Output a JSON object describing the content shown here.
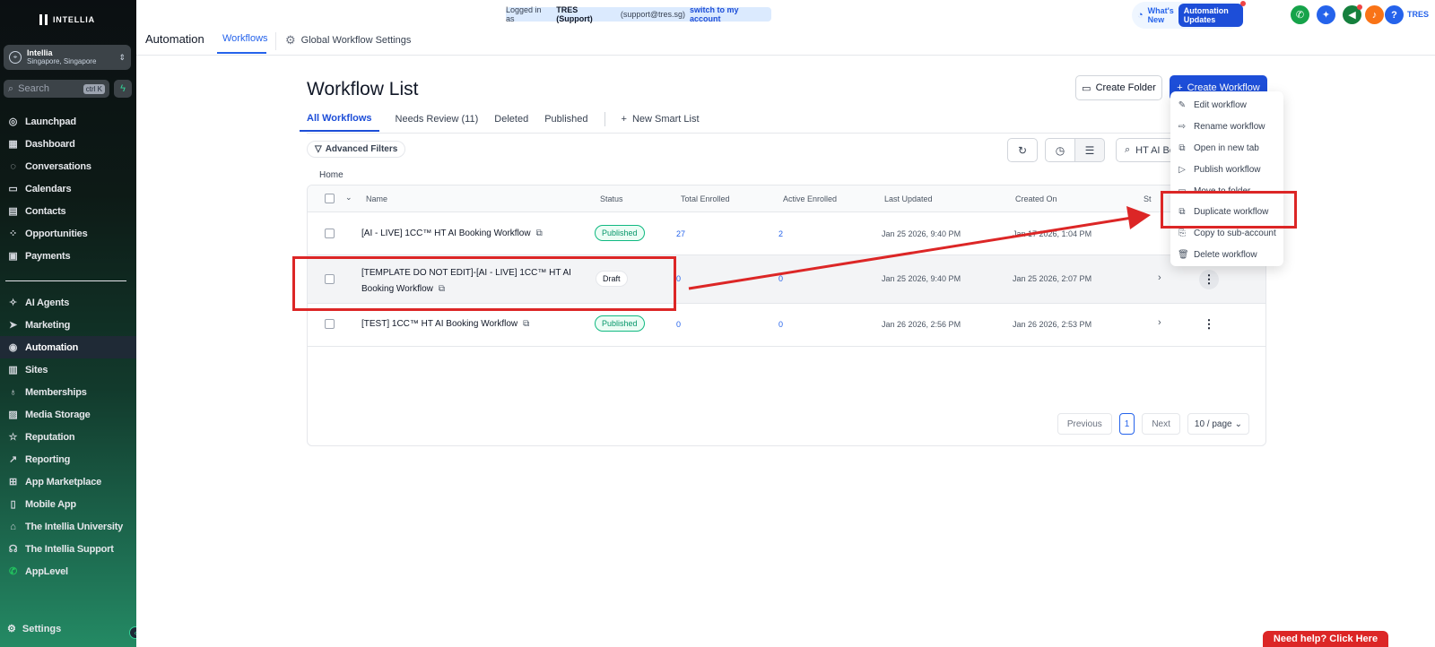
{
  "app": {
    "brand": "INTELLIA",
    "account_name": "Intellia",
    "account_location": "Singapore, Singapore"
  },
  "sidebar": {
    "search_placeholder": "Search",
    "search_shortcut": "ctrl K",
    "items": [
      {
        "label": "Launchpad",
        "icon": "rocket-icon"
      },
      {
        "label": "Dashboard",
        "icon": "grid-icon"
      },
      {
        "label": "Conversations",
        "icon": "chat-icon"
      },
      {
        "label": "Calendars",
        "icon": "calendar-icon"
      },
      {
        "label": "Contacts",
        "icon": "contacts-icon"
      },
      {
        "label": "Opportunities",
        "icon": "opportunities-icon"
      },
      {
        "label": "Payments",
        "icon": "payments-icon"
      }
    ],
    "items2": [
      {
        "label": "AI Agents",
        "icon": "sparkle-icon"
      },
      {
        "label": "Marketing",
        "icon": "send-icon"
      },
      {
        "label": "Automation",
        "icon": "automation-icon",
        "active": true
      },
      {
        "label": "Sites",
        "icon": "sites-icon"
      },
      {
        "label": "Memberships",
        "icon": "memberships-icon"
      },
      {
        "label": "Media Storage",
        "icon": "media-icon"
      },
      {
        "label": "Reputation",
        "icon": "star-icon"
      },
      {
        "label": "Reporting",
        "icon": "chart-icon"
      },
      {
        "label": "App Marketplace",
        "icon": "apps-icon"
      },
      {
        "label": "Mobile App",
        "icon": "mobile-icon"
      },
      {
        "label": "The Intellia University",
        "icon": "graduation-icon"
      },
      {
        "label": "The Intellia Support",
        "icon": "support-icon"
      },
      {
        "label": "AppLevel",
        "icon": "whatsapp-icon"
      }
    ],
    "settings_label": "Settings"
  },
  "topbar": {
    "page_title": "Automation",
    "tab_workflows": "Workflows",
    "global_settings": "Global Workflow Settings",
    "login_prefix": "Logged in as",
    "login_user": "TRES (Support)",
    "login_email": "(support@tres.sg)",
    "login_switch": "switch to my account",
    "whats_new": "What's New",
    "automation_updates": "Automation Updates",
    "user_initials": "TRES"
  },
  "main": {
    "title": "Workflow List",
    "create_folder": "Create Folder",
    "create_workflow": "Create Workflow",
    "tabs": [
      "All Workflows",
      "Needs Review (11)",
      "Deleted",
      "Published"
    ],
    "new_smart_list": "New Smart List",
    "advanced_filters": "Advanced Filters",
    "search_value": "HT AI Bo",
    "breadcrumb": "Home",
    "columns": [
      "Name",
      "Status",
      "Total Enrolled",
      "Active Enrolled",
      "Last Updated",
      "Created On",
      "St"
    ],
    "rows": [
      {
        "name": "[AI - LIVE] 1CC™ HT AI Booking Workflow",
        "status": "Published",
        "total": "27",
        "active": "2",
        "updated": "Jan 25 2026, 9:40 PM",
        "created": "Jan 17 2026, 1:04 PM"
      },
      {
        "name_line1": "[TEMPLATE DO NOT EDIT]-[AI - LIVE] 1CC™ HT AI",
        "name_line2": "Booking Workflow",
        "status": "Draft",
        "total": "0",
        "active": "0",
        "updated": "Jan 25 2026, 9:40 PM",
        "created": "Jan 25 2026, 2:07 PM"
      },
      {
        "name": "[TEST] 1CC™ HT AI Booking Workflow",
        "status": "Published",
        "total": "0",
        "active": "0",
        "updated": "Jan 26 2026, 2:56 PM",
        "created": "Jan 26 2026, 2:53 PM"
      }
    ],
    "pager": {
      "previous": "Previous",
      "page": "1",
      "next": "Next",
      "per_page": "10 / page"
    }
  },
  "menu": {
    "items": [
      {
        "label": "Edit workflow",
        "icon": "pencil-icon"
      },
      {
        "label": "Rename workflow",
        "icon": "rename-icon"
      },
      {
        "label": "Open in new tab",
        "icon": "external-link-icon"
      },
      {
        "label": "Publish workflow",
        "icon": "play-icon"
      },
      {
        "label": "Move to folder",
        "icon": "folder-icon"
      },
      {
        "label": "Duplicate workflow",
        "icon": "copy-icon"
      },
      {
        "label": "Copy to sub-account",
        "icon": "copy-sub-icon"
      },
      {
        "label": "Delete workflow",
        "icon": "trash-icon"
      }
    ]
  },
  "help": {
    "label": "Need help? Click Here"
  },
  "colors": {
    "accent": "#1d4ed8",
    "annotation": "#dc2626",
    "published": "#10b981"
  }
}
